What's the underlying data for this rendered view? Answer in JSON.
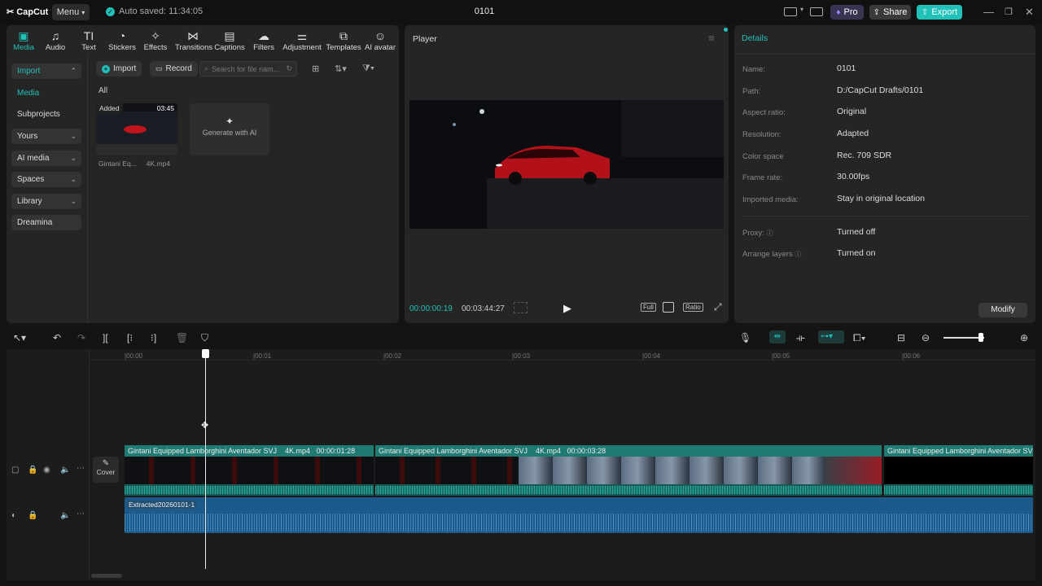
{
  "app": {
    "logo": "CapCut",
    "menu": "Menu",
    "autosave": "Auto saved: 11:34:05",
    "project_title": "0101"
  },
  "titlebar": {
    "pro": "Pro",
    "share": "Share",
    "export": "Export"
  },
  "media_tabs": [
    "Media",
    "Audio",
    "Text",
    "Stickers",
    "Effects",
    "Transitions",
    "Captions",
    "Filters",
    "Adjustment",
    "Templates",
    "AI avatar"
  ],
  "sidebar": {
    "import": "Import",
    "media": "Media",
    "subprojects": "Subprojects",
    "yours": "Yours",
    "ai_media": "AI media",
    "spaces": "Spaces",
    "library": "Library",
    "dreamina": "Dreamina"
  },
  "media_toolbar": {
    "import": "Import",
    "record": "Record",
    "search_placeholder": "Search for file nam...",
    "filter_all": "All"
  },
  "media_item": {
    "badge": "Added",
    "duration": "03:45",
    "name": "Gintani Eq...",
    "name_suffix": "4K.mp4"
  },
  "gen_ai": "Generate with AI",
  "player": {
    "title": "Player",
    "current_time": "00:00:00:19",
    "total_time": "00:03:44:27",
    "full": "Full",
    "ratio": "Ratio"
  },
  "details": {
    "title": "Details",
    "rows": [
      {
        "label": "Name:",
        "value": "0101"
      },
      {
        "label": "Path:",
        "value": "D:/CapCut Drafts/0101"
      },
      {
        "label": "Aspect ratio:",
        "value": "Original"
      },
      {
        "label": "Resolution:",
        "value": "Adapted"
      },
      {
        "label": "Color space",
        "value": "Rec. 709 SDR"
      },
      {
        "label": "Frame rate:",
        "value": "30.00fps"
      },
      {
        "label": "Imported media:",
        "value": "Stay in original location"
      }
    ],
    "rows2": [
      {
        "label": "Proxy:",
        "value": "Turned off"
      },
      {
        "label": "Arrange layers",
        "value": "Turned on"
      }
    ],
    "modify": "Modify"
  },
  "timeline": {
    "ruler": [
      "|00:00",
      "|00:01",
      "|00:02",
      "|00:03",
      "|00:04",
      "|00:05",
      "|00:06"
    ],
    "cover": "Cover",
    "clips": [
      {
        "name": "Gintani Equipped Lamborghini Aventador SVJ",
        "file": "4K.mp4",
        "duration": "00:00:01:28"
      },
      {
        "name": "Gintani Equipped Lamborghini Aventador SVJ",
        "file": "4K.mp4",
        "duration": "00:00:03:28"
      },
      {
        "name": "Gintani Equipped Lamborghini Aventador SVJ",
        "file": "",
        "duration": ""
      }
    ],
    "audio_clip": "Extracted20260101-1"
  },
  "colors": {
    "accent": "#20c1b8",
    "video_clip": "#1f7a72",
    "audio_clip": "#1b5a8a",
    "pro": "#5b4bd6"
  }
}
